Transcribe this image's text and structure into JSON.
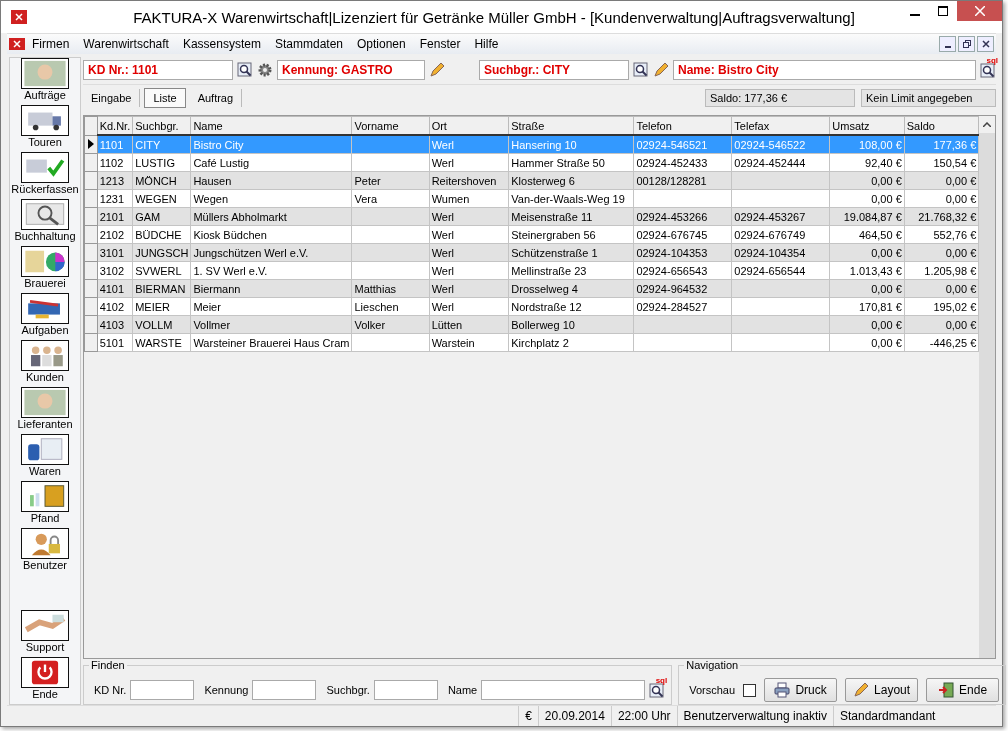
{
  "window": {
    "title": "FAKTURA-X Warenwirtschaft|Lizenziert für Getränke Müller GmbH - [Kundenverwaltung|Auftragsverwaltung]"
  },
  "menu": [
    "Firmen",
    "Warenwirtschaft",
    "Kassensystem",
    "Stammdaten",
    "Optionen",
    "Fenster",
    "Hilfe"
  ],
  "header_fields": {
    "kd_nr": "KD Nr.: 1101",
    "kennung": "Kennung: GASTRO",
    "suchbgr": "Suchbgr.: CITY",
    "name": "Name: Bistro City",
    "sql_badge": "sql"
  },
  "tabs": [
    {
      "label": "Eingabe",
      "selected": false
    },
    {
      "label": "Liste",
      "selected": true
    },
    {
      "label": "Auftrag",
      "selected": false
    }
  ],
  "saldo": "Saldo: 177,36 €",
  "limit": "Kein Limit angegeben",
  "sidebar": {
    "items": [
      {
        "label": "Aufträge",
        "kind": "photo"
      },
      {
        "label": "Touren",
        "kind": "truck"
      },
      {
        "label": "Rückerfassen",
        "kind": "check"
      },
      {
        "label": "Buchhaltung",
        "kind": "magnifier"
      },
      {
        "label": "Brauerei",
        "kind": "chart"
      },
      {
        "label": "Aufgaben",
        "kind": "tools"
      },
      {
        "label": "Kunden",
        "kind": "people"
      },
      {
        "label": "Lieferanten",
        "kind": "photo"
      },
      {
        "label": "Waren",
        "kind": "barrel"
      },
      {
        "label": "Pfand",
        "kind": "crate"
      },
      {
        "label": "Benutzer",
        "kind": "user"
      },
      {
        "label": "Support",
        "kind": "handshake"
      },
      {
        "label": "Ende",
        "kind": "power"
      }
    ]
  },
  "table": {
    "columns": [
      "Kd.Nr.",
      "Suchbgr.",
      "Name",
      "Vorname",
      "Ort",
      "Straße",
      "Telefon",
      "Telefax",
      "Umsatz",
      "Saldo"
    ],
    "rows": [
      {
        "selected": true,
        "cells": [
          "1101",
          "CITY",
          "Bistro City",
          "",
          "Werl",
          "Hansering 10",
          "02924-546521",
          "02924-546522",
          "108,00 €",
          "177,36 €"
        ]
      },
      {
        "selected": false,
        "cells": [
          "1102",
          "LUSTIG",
          "Café Lustig",
          "",
          "Werl",
          "Hammer Straße 50",
          "02924-452433",
          "02924-452444",
          "92,40 €",
          "150,54 €"
        ]
      },
      {
        "selected": false,
        "cells": [
          "1213",
          "MÖNCH",
          "Hausen",
          "Peter",
          "Reitershoven",
          "Klosterweg 6",
          "00128/128281",
          "",
          "0,00 €",
          "0,00 €"
        ]
      },
      {
        "selected": false,
        "cells": [
          "1231",
          "WEGEN",
          "Wegen",
          "Vera",
          "Wumen",
          "Van-der-Waals-Weg 19",
          "",
          "",
          "0,00 €",
          "0,00 €"
        ]
      },
      {
        "selected": false,
        "cells": [
          "2101",
          "GAM",
          "Müllers Abholmarkt",
          "",
          "Werl",
          "Meisenstraße 11",
          "02924-453266",
          "02924-453267",
          "19.084,87 €",
          "21.768,32 €"
        ]
      },
      {
        "selected": false,
        "cells": [
          "2102",
          "BÜDCHE",
          "Kiosk Büdchen",
          "",
          "Werl",
          "Steinergraben 56",
          "02924-676745",
          "02924-676749",
          "464,50 €",
          "552,76 €"
        ]
      },
      {
        "selected": false,
        "cells": [
          "3101",
          "JUNGSCH",
          "Jungschützen Werl e.V.",
          "",
          "Werl",
          "Schützenstraße 1",
          "02924-104353",
          "02924-104354",
          "0,00 €",
          "0,00 €"
        ]
      },
      {
        "selected": false,
        "cells": [
          "3102",
          "SVWERL",
          "1. SV Werl e.V.",
          "",
          "Werl",
          "Mellinstraße 23",
          "02924-656543",
          "02924-656544",
          "1.013,43 €",
          "1.205,98 €"
        ]
      },
      {
        "selected": false,
        "cells": [
          "4101",
          "BIERMAN",
          "Biermann",
          "Matthias",
          "Werl",
          "Drosselweg 4",
          "02924-964532",
          "",
          "0,00 €",
          "0,00 €"
        ]
      },
      {
        "selected": false,
        "cells": [
          "4102",
          "MEIER",
          "Meier",
          "Lieschen",
          "Werl",
          "Nordstraße 12",
          "02924-284527",
          "",
          "170,81 €",
          "195,02 €"
        ]
      },
      {
        "selected": false,
        "cells": [
          "4103",
          "VOLLM",
          "Vollmer",
          "Volker",
          "Lütten",
          "Bollerweg 10",
          "",
          "",
          "0,00 €",
          "0,00 €"
        ]
      },
      {
        "selected": false,
        "cells": [
          "5101",
          "WARSTE",
          "Warsteiner Brauerei Haus Cram",
          "",
          "Warstein",
          "Kirchplatz 2",
          "",
          "",
          "0,00 €",
          "-446,25 €"
        ]
      }
    ]
  },
  "find": {
    "title": "Finden",
    "fields": [
      "KD Nr.",
      "Kennung",
      "Suchbgr.",
      "Name"
    ],
    "sql_badge": "sql"
  },
  "navigation": {
    "title": "Navigation",
    "preview": {
      "label": "Vorschau",
      "checked": false
    },
    "buttons": [
      {
        "label": "Druck",
        "kind": "printer"
      },
      {
        "label": "Layout",
        "kind": "pencil"
      },
      {
        "label": "Ende",
        "kind": "exit"
      }
    ]
  },
  "status_bar": [
    "€",
    "20.09.2014",
    "22:00 Uhr",
    "Benutzerverwaltung inaktiv",
    "Standardmandant"
  ]
}
